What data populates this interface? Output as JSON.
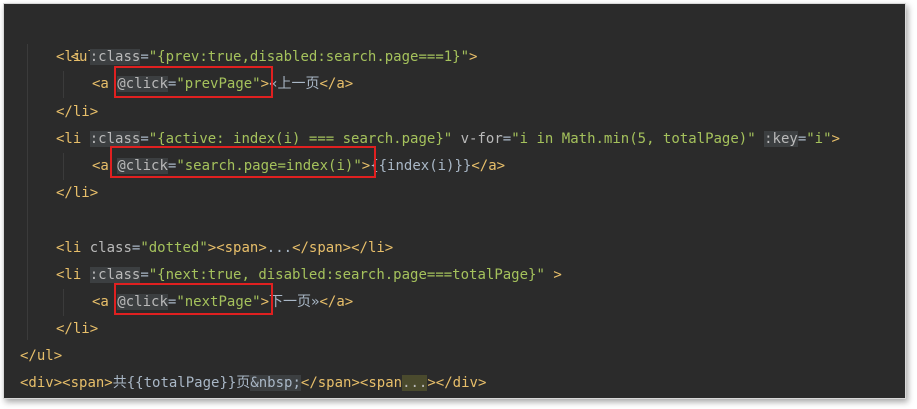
{
  "editor": {
    "line_ul_open": "<ul>",
    "li1_open": "<li",
    "li1_attr": ":class",
    "li1_eq": "=",
    "li1_val": "\"{prev:true,disabled:search.page===1}\"",
    "li1_close": ">",
    "a1_open": "<a",
    "a1_event": "@click",
    "a1_eq": "=",
    "a1_val": "\"prevPage\"",
    "a1_gt": ">",
    "a1_text": "«上一页",
    "a1_close": "</a>",
    "li1_end": "</li>",
    "li2_open": "<li",
    "li2_attr1": ":class",
    "li2_eq1": "=",
    "li2_val1": "\"{active: index(i) === search.page}\"",
    "li2_attr2": "v-for",
    "li2_eq2": "=",
    "li2_val2": "\"i in Math.min(5, totalPage)\"",
    "li2_attr3": ":key",
    "li2_eq3": "=",
    "li2_val3": "\"i\"",
    "li2_close": ">",
    "a2_open": "<a",
    "a2_event": "@click",
    "a2_eq": "=",
    "a2_val": "\"search.page=index(i)\"",
    "a2_gt": ">",
    "a2_text": "{{index(i)}}",
    "a2_close": "</a>",
    "li2_end": "</li>",
    "li3_open": "<li",
    "li3_attr": "class",
    "li3_eq": "=",
    "li3_val": "\"dotted\"",
    "li3_gt": ">",
    "span3_open": "<span>",
    "span3_text": "...",
    "span3_close": "</span>",
    "li3_end": "</li>",
    "li4_open": "<li",
    "li4_attr": ":class",
    "li4_eq": "=",
    "li4_val": "\"{next:true, disabled:search.page===totalPage}\"",
    "li4_close": " >",
    "a4_open": "<a",
    "a4_event": "@click",
    "a4_eq": "=",
    "a4_val": "\"nextPage\"",
    "a4_gt": ">",
    "a4_text": "下一页»",
    "a4_close": "</a>",
    "li4_end": "</li>",
    "line_ul_close": "</ul>",
    "div_open": "<div>",
    "span5_open": "<span>",
    "span5_text1": "共{{totalPage}}页",
    "span5_ent": "&nbsp;",
    "span5_close": "</span>",
    "span6_open": "<span",
    "span6_dots": "...",
    "span6_gt": ">",
    "div_close": "</div>"
  },
  "colors": {
    "background": "#2b2b2b",
    "tag": "#e8bf6a",
    "attribute": "#bababa",
    "string": "#a5c25c",
    "text": "#a9b7c6",
    "highlight_box": "#e02020"
  }
}
